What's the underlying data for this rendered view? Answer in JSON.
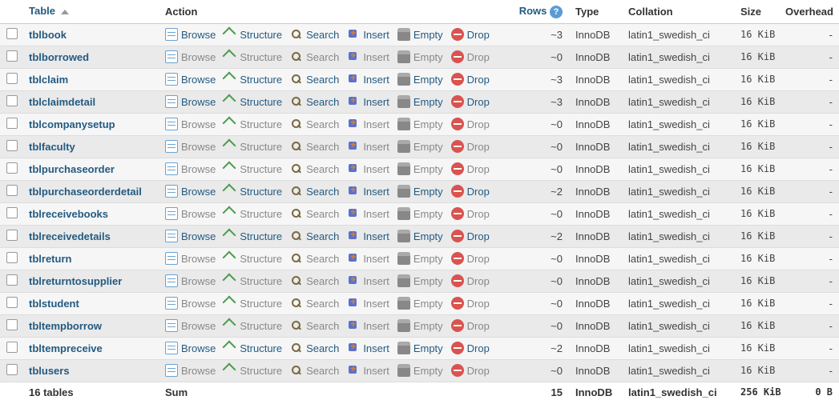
{
  "headers": {
    "table": "Table",
    "action": "Action",
    "rows": "Rows",
    "type": "Type",
    "collation": "Collation",
    "size": "Size",
    "overhead": "Overhead"
  },
  "actions": {
    "browse": "Browse",
    "structure": "Structure",
    "search": "Search",
    "insert": "Insert",
    "empty": "Empty",
    "drop": "Drop"
  },
  "tables": [
    {
      "name": "tblbook",
      "rows": "~3",
      "rows_num": 3,
      "type": "InnoDB",
      "collation": "latin1_swedish_ci",
      "size": "16 KiB",
      "overhead": "-",
      "disabled": false
    },
    {
      "name": "tblborrowed",
      "rows": "~0",
      "rows_num": 0,
      "type": "InnoDB",
      "collation": "latin1_swedish_ci",
      "size": "16 KiB",
      "overhead": "-",
      "disabled": true
    },
    {
      "name": "tblclaim",
      "rows": "~3",
      "rows_num": 3,
      "type": "InnoDB",
      "collation": "latin1_swedish_ci",
      "size": "16 KiB",
      "overhead": "-",
      "disabled": false
    },
    {
      "name": "tblclaimdetail",
      "rows": "~3",
      "rows_num": 3,
      "type": "InnoDB",
      "collation": "latin1_swedish_ci",
      "size": "16 KiB",
      "overhead": "-",
      "disabled": false
    },
    {
      "name": "tblcompanysetup",
      "rows": "~0",
      "rows_num": 0,
      "type": "InnoDB",
      "collation": "latin1_swedish_ci",
      "size": "16 KiB",
      "overhead": "-",
      "disabled": true
    },
    {
      "name": "tblfaculty",
      "rows": "~0",
      "rows_num": 0,
      "type": "InnoDB",
      "collation": "latin1_swedish_ci",
      "size": "16 KiB",
      "overhead": "-",
      "disabled": true
    },
    {
      "name": "tblpurchaseorder",
      "rows": "~0",
      "rows_num": 0,
      "type": "InnoDB",
      "collation": "latin1_swedish_ci",
      "size": "16 KiB",
      "overhead": "-",
      "disabled": true
    },
    {
      "name": "tblpurchaseorderdetail",
      "rows": "~2",
      "rows_num": 2,
      "type": "InnoDB",
      "collation": "latin1_swedish_ci",
      "size": "16 KiB",
      "overhead": "-",
      "disabled": false
    },
    {
      "name": "tblreceivebooks",
      "rows": "~0",
      "rows_num": 0,
      "type": "InnoDB",
      "collation": "latin1_swedish_ci",
      "size": "16 KiB",
      "overhead": "-",
      "disabled": true
    },
    {
      "name": "tblreceivedetails",
      "rows": "~2",
      "rows_num": 2,
      "type": "InnoDB",
      "collation": "latin1_swedish_ci",
      "size": "16 KiB",
      "overhead": "-",
      "disabled": false
    },
    {
      "name": "tblreturn",
      "rows": "~0",
      "rows_num": 0,
      "type": "InnoDB",
      "collation": "latin1_swedish_ci",
      "size": "16 KiB",
      "overhead": "-",
      "disabled": true
    },
    {
      "name": "tblreturntosupplier",
      "rows": "~0",
      "rows_num": 0,
      "type": "InnoDB",
      "collation": "latin1_swedish_ci",
      "size": "16 KiB",
      "overhead": "-",
      "disabled": true
    },
    {
      "name": "tblstudent",
      "rows": "~0",
      "rows_num": 0,
      "type": "InnoDB",
      "collation": "latin1_swedish_ci",
      "size": "16 KiB",
      "overhead": "-",
      "disabled": true
    },
    {
      "name": "tbltempborrow",
      "rows": "~0",
      "rows_num": 0,
      "type": "InnoDB",
      "collation": "latin1_swedish_ci",
      "size": "16 KiB",
      "overhead": "-",
      "disabled": true
    },
    {
      "name": "tbltempreceive",
      "rows": "~2",
      "rows_num": 2,
      "type": "InnoDB",
      "collation": "latin1_swedish_ci",
      "size": "16 KiB",
      "overhead": "-",
      "disabled": false
    },
    {
      "name": "tblusers",
      "rows": "~0",
      "rows_num": 0,
      "type": "InnoDB",
      "collation": "latin1_swedish_ci",
      "size": "16 KiB",
      "overhead": "-",
      "disabled": true
    }
  ],
  "footer": {
    "count_label": "16 tables",
    "sum_label": "Sum",
    "sum_rows": "15",
    "type": "InnoDB",
    "collation": "latin1_swedish_ci",
    "size": "256 KiB",
    "overhead": "0 B"
  }
}
